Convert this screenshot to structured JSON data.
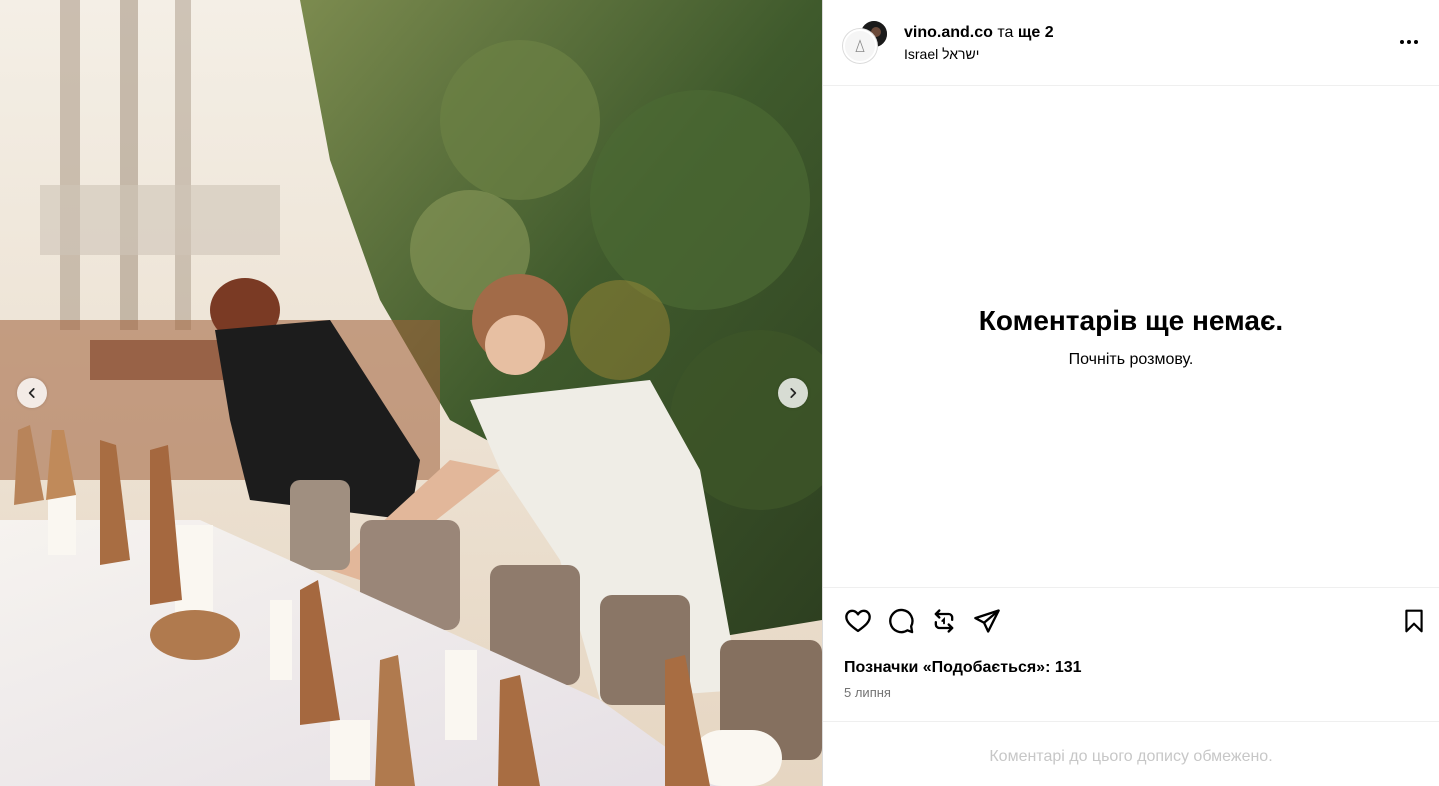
{
  "header": {
    "username": "vino.and.co",
    "conjunction": "та",
    "more_authors": "ще 2",
    "location": "Israel ישראל"
  },
  "comments": {
    "empty_title": "Коментарів ще немає.",
    "empty_subtitle": "Почніть розмову."
  },
  "actions": {
    "likes_text": "Позначки «Подобається»: 131",
    "date": "5 липня"
  },
  "footer": {
    "restricted_text": "Коментарі до цього допису обмежено."
  },
  "icons": {
    "prev": "chevron-left-icon",
    "next": "chevron-right-icon",
    "more": "more-horizontal-icon",
    "like": "heart-icon",
    "comment": "comment-icon",
    "repost": "repost-icon",
    "share": "send-icon",
    "save": "bookmark-icon"
  },
  "colors": {
    "text": "#000000",
    "muted": "#737373",
    "border": "#efefef",
    "restricted": "#c7c7c7"
  }
}
